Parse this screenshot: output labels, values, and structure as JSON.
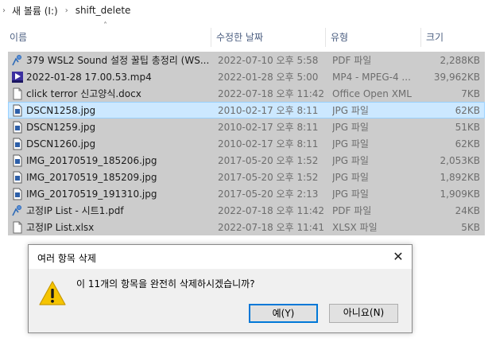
{
  "breadcrumb": {
    "drive": "새 볼륨 (I:)",
    "folder": "shift_delete"
  },
  "columns": {
    "name": "이름",
    "date": "수정한 날짜",
    "type": "유형",
    "size": "크기"
  },
  "files": [
    {
      "name": "379 WSL2 Sound 설정 꿀팁 총정리 (WS...",
      "date": "2022-07-10 오후 5:58",
      "type": "PDF 파일",
      "size": "2,288KB",
      "icon": "pdf-icon"
    },
    {
      "name": "2022-01-28 17.00.53.mp4",
      "date": "2022-01-28 오후 5:00",
      "type": "MP4 - MPEG-4 ...",
      "size": "39,962KB",
      "icon": "video-icon"
    },
    {
      "name": "click terror 신고양식.docx",
      "date": "2022-07-18 오후 11:42",
      "type": "Office Open XML ...",
      "size": "7KB",
      "icon": "document-icon"
    },
    {
      "name": "DSCN1258.jpg",
      "date": "2010-02-17 오후 8:11",
      "type": "JPG 파일",
      "size": "62KB",
      "icon": "image-icon"
    },
    {
      "name": "DSCN1259.jpg",
      "date": "2010-02-17 오후 8:11",
      "type": "JPG 파일",
      "size": "51KB",
      "icon": "image-icon"
    },
    {
      "name": "DSCN1260.jpg",
      "date": "2010-02-17 오후 8:11",
      "type": "JPG 파일",
      "size": "62KB",
      "icon": "image-icon"
    },
    {
      "name": "IMG_20170519_185206.jpg",
      "date": "2017-05-20 오후 1:52",
      "type": "JPG 파일",
      "size": "2,053KB",
      "icon": "image-icon"
    },
    {
      "name": "IMG_20170519_185209.jpg",
      "date": "2017-05-20 오후 1:52",
      "type": "JPG 파일",
      "size": "1,892KB",
      "icon": "image-icon"
    },
    {
      "name": "IMG_20170519_191310.jpg",
      "date": "2017-05-20 오후 2:13",
      "type": "JPG 파일",
      "size": "1,909KB",
      "icon": "image-icon"
    },
    {
      "name": "고정IP List - 시트1.pdf",
      "date": "2022-07-18 오후 11:42",
      "type": "PDF 파일",
      "size": "24KB",
      "icon": "pdf-icon"
    },
    {
      "name": "고정IP List.xlsx",
      "date": "2022-07-18 오후 11:41",
      "type": "XLSX 파일",
      "size": "5KB",
      "icon": "document-icon"
    }
  ],
  "dialog": {
    "title": "여러 항목 삭제",
    "message": "이 11개의 항목을 완전히 삭제하시겠습니까?",
    "yes_label": "예(Y)",
    "no_label": "아니요(N)"
  },
  "colors": {
    "selection": "#cccccc",
    "focus_row": "#cce8ff",
    "header_text": "#4d6082",
    "default_button_border": "#0078d7"
  }
}
